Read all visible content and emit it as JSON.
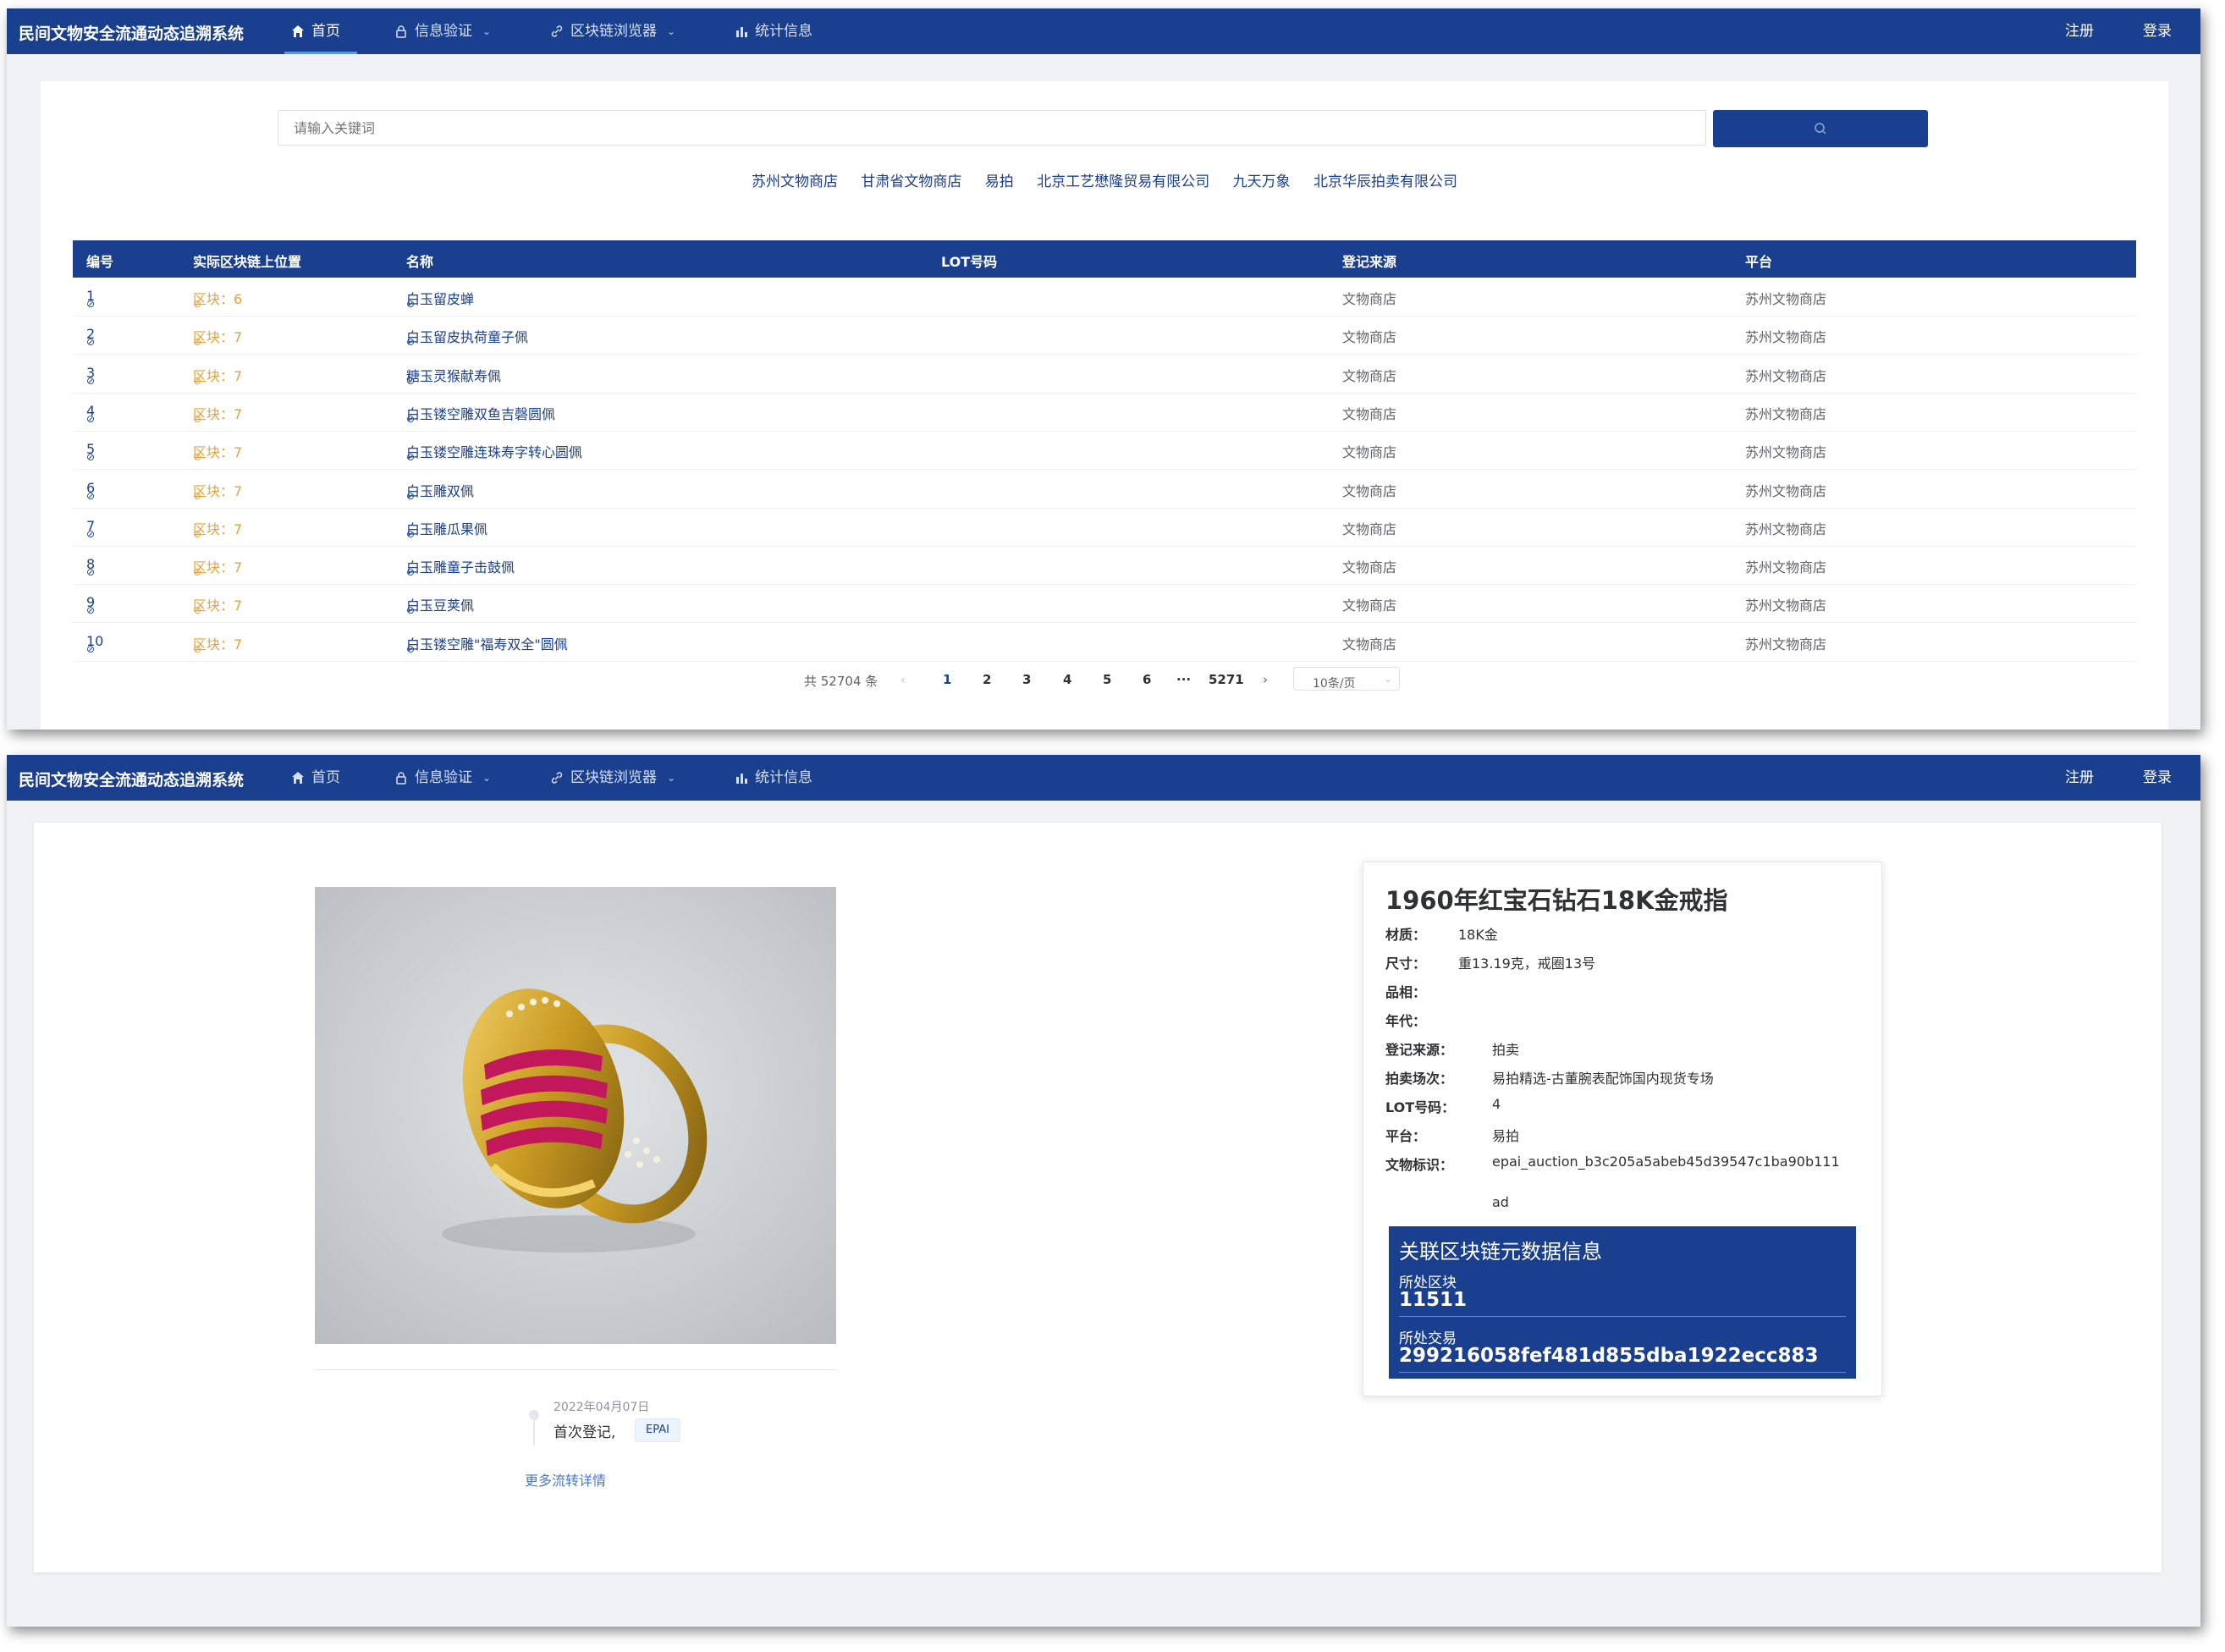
{
  "app": {
    "brand": "民间文物安全流通动态追溯系统",
    "nav": [
      {
        "label": "首页",
        "icon": "home-icon"
      },
      {
        "label": "信息验证",
        "icon": "lock-icon"
      },
      {
        "label": "区块链浏览器",
        "icon": "link-icon"
      },
      {
        "label": "统计信息",
        "icon": "bar-chart-icon"
      }
    ],
    "register": "注册",
    "login": "登录"
  },
  "search": {
    "placeholder": "请输入关键词",
    "quick_links": [
      "苏州文物商店",
      "甘肃省文物商店",
      "易拍",
      "北京工艺懋隆贸易有限公司",
      "九天万象",
      "北京华辰拍卖有限公司"
    ]
  },
  "table": {
    "headers": [
      "编号",
      "实际区块链上位置",
      "名称",
      "LOT号码",
      "登记来源",
      "平台"
    ],
    "rows": [
      {
        "id": "1",
        "block": "区块：6",
        "name": "白玉留皮蝉",
        "lot": "",
        "source": "文物商店",
        "platform": "苏州文物商店"
      },
      {
        "id": "2",
        "block": "区块：7",
        "name": "白玉留皮执荷童子佩",
        "lot": "",
        "source": "文物商店",
        "platform": "苏州文物商店"
      },
      {
        "id": "3",
        "block": "区块：7",
        "name": "糖玉灵猴献寿佩",
        "lot": "",
        "source": "文物商店",
        "platform": "苏州文物商店"
      },
      {
        "id": "4",
        "block": "区块：7",
        "name": "白玉镂空雕双鱼吉磬圆佩",
        "lot": "",
        "source": "文物商店",
        "platform": "苏州文物商店"
      },
      {
        "id": "5",
        "block": "区块：7",
        "name": "白玉镂空雕连珠寿字转心圆佩",
        "lot": "",
        "source": "文物商店",
        "platform": "苏州文物商店"
      },
      {
        "id": "6",
        "block": "区块：7",
        "name": "白玉雕双佩",
        "lot": "",
        "source": "文物商店",
        "platform": "苏州文物商店"
      },
      {
        "id": "7",
        "block": "区块：7",
        "name": "白玉雕瓜果佩",
        "lot": "",
        "source": "文物商店",
        "platform": "苏州文物商店"
      },
      {
        "id": "8",
        "block": "区块：7",
        "name": "白玉雕童子击鼓佩",
        "lot": "",
        "source": "文物商店",
        "platform": "苏州文物商店"
      },
      {
        "id": "9",
        "block": "区块：7",
        "name": "白玉豆荚佩",
        "lot": "",
        "source": "文物商店",
        "platform": "苏州文物商店"
      },
      {
        "id": "10",
        "block": "区块：7",
        "name": "白玉镂空雕\"福寿双全\"圆佩",
        "lot": "",
        "source": "文物商店",
        "platform": "苏州文物商店"
      }
    ]
  },
  "pagination": {
    "total": "共 52704 条",
    "pages": [
      "1",
      "2",
      "3",
      "4",
      "5",
      "6",
      "···",
      "5271"
    ],
    "page_size": "10条/页"
  },
  "detail": {
    "title": "1960年红宝石钻石18K金戒指",
    "fields": [
      {
        "k": "材质：",
        "v": "18K金"
      },
      {
        "k": "尺寸：",
        "v": "重13.19克，戒圈13号"
      },
      {
        "k": "品相：",
        "v": ""
      },
      {
        "k": "年代：",
        "v": ""
      },
      {
        "k": "登记来源：",
        "v": "拍卖"
      },
      {
        "k": "拍卖场次：",
        "v": "易拍精选-古董腕表配饰国内现货专场"
      },
      {
        "k": "LOT号码：",
        "v": "4"
      },
      {
        "k": "平台：",
        "v": "易拍"
      },
      {
        "k": "文物标识：",
        "v": "epai_auction_b3c205a5abeb45d39547c1ba90b111"
      }
    ],
    "id_wrap": "ad",
    "chain": {
      "title": "关联区块链元数据信息",
      "block_label": "所处区块",
      "block_value": "11511",
      "tx_label": "所处交易",
      "tx_value": "299216058fef481d855dba1922ecc883"
    },
    "timeline": {
      "date": "2022年04月07日",
      "text": "首次登记,",
      "tag": "EPAI",
      "more": "更多流转详情"
    }
  }
}
